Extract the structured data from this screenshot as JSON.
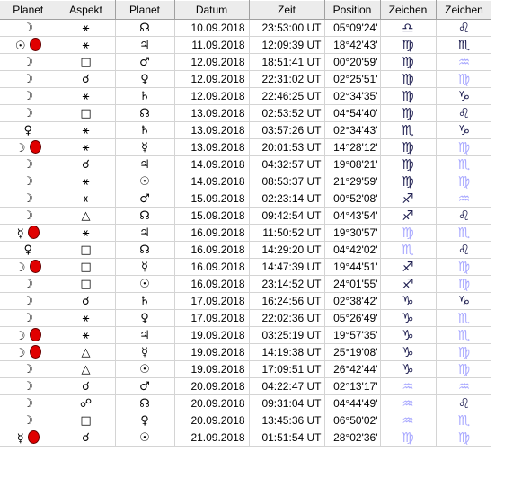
{
  "headers": [
    "Planet",
    "Aspekt",
    "Planet",
    "Datum",
    "Zeit",
    "Position",
    "Zeichen",
    "Zeichen"
  ],
  "rows": [
    {
      "p1": "☽",
      "p1_dot": false,
      "aspect": "⚹",
      "p2": "☊",
      "date": "10.09.2018",
      "time": "23:53:00 UT",
      "pos": "05°09'24'",
      "sign1": "♎",
      "sign1_faint": false,
      "sign2": "♌",
      "sign2_faint": false
    },
    {
      "p1": "☉",
      "p1_dot": true,
      "aspect": "⚹",
      "p2": "♃",
      "date": "11.09.2018",
      "time": "12:09:39 UT",
      "pos": "18°42'43'",
      "sign1": "♍",
      "sign1_faint": false,
      "sign2": "♏",
      "sign2_faint": false
    },
    {
      "p1": "☽",
      "p1_dot": false,
      "aspect": "□",
      "p2": "♂",
      "date": "12.09.2018",
      "time": "18:51:41 UT",
      "pos": "00°20'59'",
      "sign1": "♍",
      "sign1_faint": false,
      "sign2": "♒",
      "sign2_faint": true
    },
    {
      "p1": "☽",
      "p1_dot": false,
      "aspect": "☌",
      "p2": "♀",
      "date": "12.09.2018",
      "time": "22:31:02 UT",
      "pos": "02°25'51'",
      "sign1": "♍",
      "sign1_faint": false,
      "sign2": "♍",
      "sign2_faint": true
    },
    {
      "p1": "☽",
      "p1_dot": false,
      "aspect": "⚹",
      "p2": "♄",
      "date": "12.09.2018",
      "time": "22:46:25 UT",
      "pos": "02°34'35'",
      "sign1": "♍",
      "sign1_faint": false,
      "sign2": "♑",
      "sign2_faint": false
    },
    {
      "p1": "☽",
      "p1_dot": false,
      "aspect": "□",
      "p2": "☊",
      "date": "13.09.2018",
      "time": "02:53:52 UT",
      "pos": "04°54'40'",
      "sign1": "♍",
      "sign1_faint": false,
      "sign2": "♌",
      "sign2_faint": false
    },
    {
      "p1": "♀",
      "p1_dot": false,
      "aspect": "⚹",
      "p2": "♄",
      "date": "13.09.2018",
      "time": "03:57:26 UT",
      "pos": "02°34'43'",
      "sign1": "♏",
      "sign1_faint": false,
      "sign2": "♑",
      "sign2_faint": false
    },
    {
      "p1": "☽",
      "p1_dot": true,
      "aspect": "⚹",
      "p2": "☿",
      "date": "13.09.2018",
      "time": "20:01:53 UT",
      "pos": "14°28'12'",
      "sign1": "♍",
      "sign1_faint": false,
      "sign2": "♍",
      "sign2_faint": true
    },
    {
      "p1": "☽",
      "p1_dot": false,
      "aspect": "☌",
      "p2": "♃",
      "date": "14.09.2018",
      "time": "04:32:57 UT",
      "pos": "19°08'21'",
      "sign1": "♍",
      "sign1_faint": false,
      "sign2": "♏",
      "sign2_faint": true
    },
    {
      "p1": "☽",
      "p1_dot": false,
      "aspect": "⚹",
      "p2": "☉",
      "date": "14.09.2018",
      "time": "08:53:37 UT",
      "pos": "21°29'59'",
      "sign1": "♍",
      "sign1_faint": false,
      "sign2": "♍",
      "sign2_faint": true
    },
    {
      "p1": "☽",
      "p1_dot": false,
      "aspect": "⚹",
      "p2": "♂",
      "date": "15.09.2018",
      "time": "02:23:14 UT",
      "pos": "00°52'08'",
      "sign1": "♐",
      "sign1_faint": false,
      "sign2": "♒",
      "sign2_faint": true
    },
    {
      "p1": "☽",
      "p1_dot": false,
      "aspect": "△",
      "p2": "☊",
      "date": "15.09.2018",
      "time": "09:42:54 UT",
      "pos": "04°43'54'",
      "sign1": "♐",
      "sign1_faint": false,
      "sign2": "♌",
      "sign2_faint": false
    },
    {
      "p1": "☿",
      "p1_dot": true,
      "aspect": "⚹",
      "p2": "♃",
      "date": "16.09.2018",
      "time": "11:50:52 UT",
      "pos": "19°30'57'",
      "sign1": "♍",
      "sign1_faint": true,
      "sign2": "♏",
      "sign2_faint": true
    },
    {
      "p1": "♀",
      "p1_dot": false,
      "aspect": "□",
      "p2": "☊",
      "date": "16.09.2018",
      "time": "14:29:20 UT",
      "pos": "04°42'02'",
      "sign1": "♏",
      "sign1_faint": true,
      "sign2": "♌",
      "sign2_faint": false
    },
    {
      "p1": "☽",
      "p1_dot": true,
      "aspect": "□",
      "p2": "☿",
      "date": "16.09.2018",
      "time": "14:47:39 UT",
      "pos": "19°44'51'",
      "sign1": "♐",
      "sign1_faint": false,
      "sign2": "♍",
      "sign2_faint": true
    },
    {
      "p1": "☽",
      "p1_dot": false,
      "aspect": "□",
      "p2": "☉",
      "date": "16.09.2018",
      "time": "23:14:52 UT",
      "pos": "24°01'55'",
      "sign1": "♐",
      "sign1_faint": false,
      "sign2": "♍",
      "sign2_faint": true
    },
    {
      "p1": "☽",
      "p1_dot": false,
      "aspect": "☌",
      "p2": "♄",
      "date": "17.09.2018",
      "time": "16:24:56 UT",
      "pos": "02°38'42'",
      "sign1": "♑",
      "sign1_faint": false,
      "sign2": "♑",
      "sign2_faint": false
    },
    {
      "p1": "☽",
      "p1_dot": false,
      "aspect": "⚹",
      "p2": "♀",
      "date": "17.09.2018",
      "time": "22:02:36 UT",
      "pos": "05°26'49'",
      "sign1": "♑",
      "sign1_faint": false,
      "sign2": "♏",
      "sign2_faint": true
    },
    {
      "p1": "☽",
      "p1_dot": true,
      "aspect": "⚹",
      "p2": "♃",
      "date": "19.09.2018",
      "time": "03:25:19 UT",
      "pos": "19°57'35'",
      "sign1": "♑",
      "sign1_faint": false,
      "sign2": "♏",
      "sign2_faint": true
    },
    {
      "p1": "☽",
      "p1_dot": true,
      "aspect": "△",
      "p2": "☿",
      "date": "19.09.2018",
      "time": "14:19:38 UT",
      "pos": "25°19'08'",
      "sign1": "♑",
      "sign1_faint": false,
      "sign2": "♍",
      "sign2_faint": true
    },
    {
      "p1": "☽",
      "p1_dot": false,
      "aspect": "△",
      "p2": "☉",
      "date": "19.09.2018",
      "time": "17:09:51 UT",
      "pos": "26°42'44'",
      "sign1": "♑",
      "sign1_faint": false,
      "sign2": "♍",
      "sign2_faint": true
    },
    {
      "p1": "☽",
      "p1_dot": false,
      "aspect": "☌",
      "p2": "♂",
      "date": "20.09.2018",
      "time": "04:22:47 UT",
      "pos": "02°13'17'",
      "sign1": "♒",
      "sign1_faint": true,
      "sign2": "♒",
      "sign2_faint": true
    },
    {
      "p1": "☽",
      "p1_dot": false,
      "aspect": "☍",
      "p2": "☊",
      "date": "20.09.2018",
      "time": "09:31:04 UT",
      "pos": "04°44'49'",
      "sign1": "♒",
      "sign1_faint": true,
      "sign2": "♌",
      "sign2_faint": false
    },
    {
      "p1": "☽",
      "p1_dot": false,
      "aspect": "□",
      "p2": "♀",
      "date": "20.09.2018",
      "time": "13:45:36 UT",
      "pos": "06°50'02'",
      "sign1": "♒",
      "sign1_faint": true,
      "sign2": "♏",
      "sign2_faint": true
    },
    {
      "p1": "☿",
      "p1_dot": true,
      "aspect": "☌",
      "p2": "☉",
      "date": "21.09.2018",
      "time": "01:51:54 UT",
      "pos": "28°02'36'",
      "sign1": "♍",
      "sign1_faint": true,
      "sign2": "♍",
      "sign2_faint": true
    }
  ],
  "colors": {
    "header_bg": "#ececec",
    "grid_line": "#d4d4d4",
    "dot": "#e00000",
    "sign_dark": "#1e1e50",
    "sign_faint": "#a8a8ff"
  }
}
